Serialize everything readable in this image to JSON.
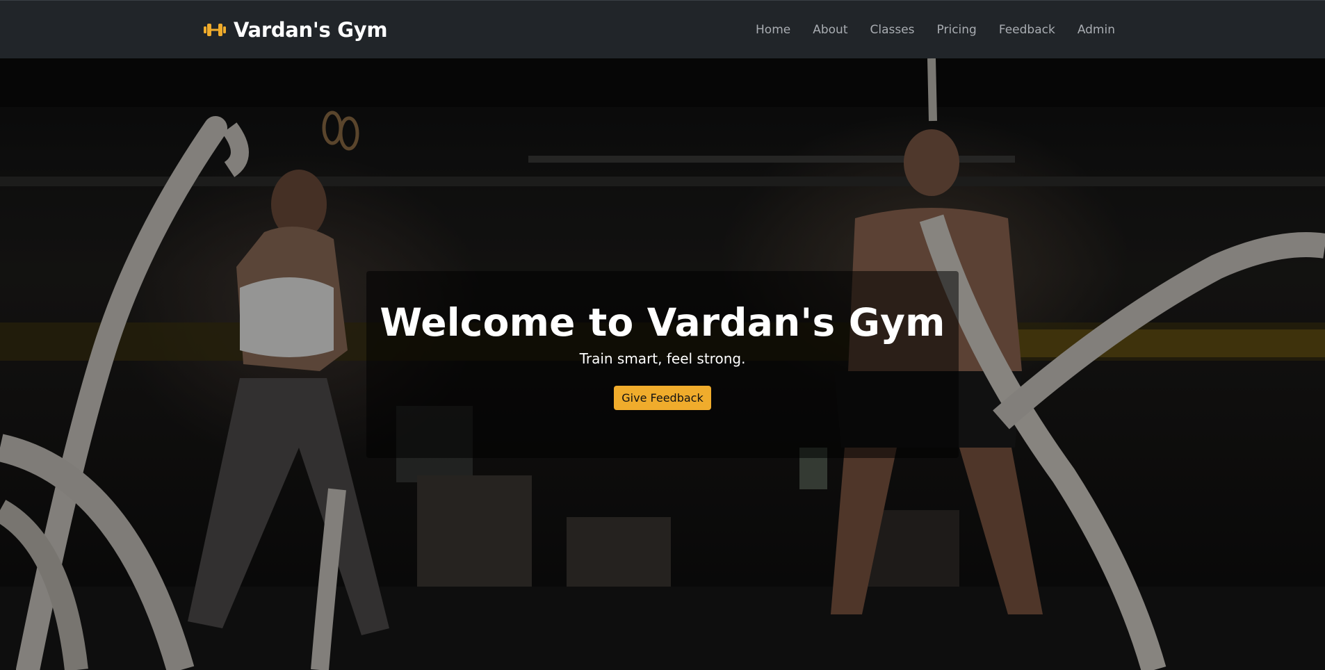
{
  "navbar": {
    "brand_icon": "dumbbell-icon",
    "brand_name": "Vardan's Gym",
    "links": [
      {
        "label": "Home"
      },
      {
        "label": "About"
      },
      {
        "label": "Classes"
      },
      {
        "label": "Pricing"
      },
      {
        "label": "Feedback"
      },
      {
        "label": "Admin"
      }
    ]
  },
  "hero": {
    "background_image": "gym-battle-ropes-photo",
    "title": "Welcome to Vardan's Gym",
    "subtitle": "Train smart, feel strong.",
    "cta_label": "Give Feedback"
  },
  "colors": {
    "navbar_bg": "#212529",
    "accent": "#f0ac2c",
    "nav_text": "#a9adb2"
  }
}
